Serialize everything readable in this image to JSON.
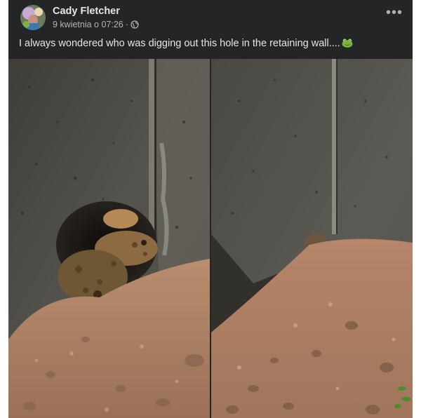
{
  "post": {
    "author": "Cady Fletcher",
    "timestamp": "9 kwietnia o 07:26",
    "separator": "·",
    "privacy_icon": "globe-icon",
    "caption": "I always wondered who was digging out this hole in the retaining wall....",
    "caption_emoji": "frog-face-icon",
    "more_label": "•••"
  },
  "photos": [
    {
      "subject": "toads in hole under concrete wall"
    },
    {
      "subject": "hole covered with dirt under concrete wall"
    }
  ],
  "colors": {
    "background": "#242526",
    "text_primary": "#e4e6eb",
    "text_secondary": "#b0b3b8"
  }
}
